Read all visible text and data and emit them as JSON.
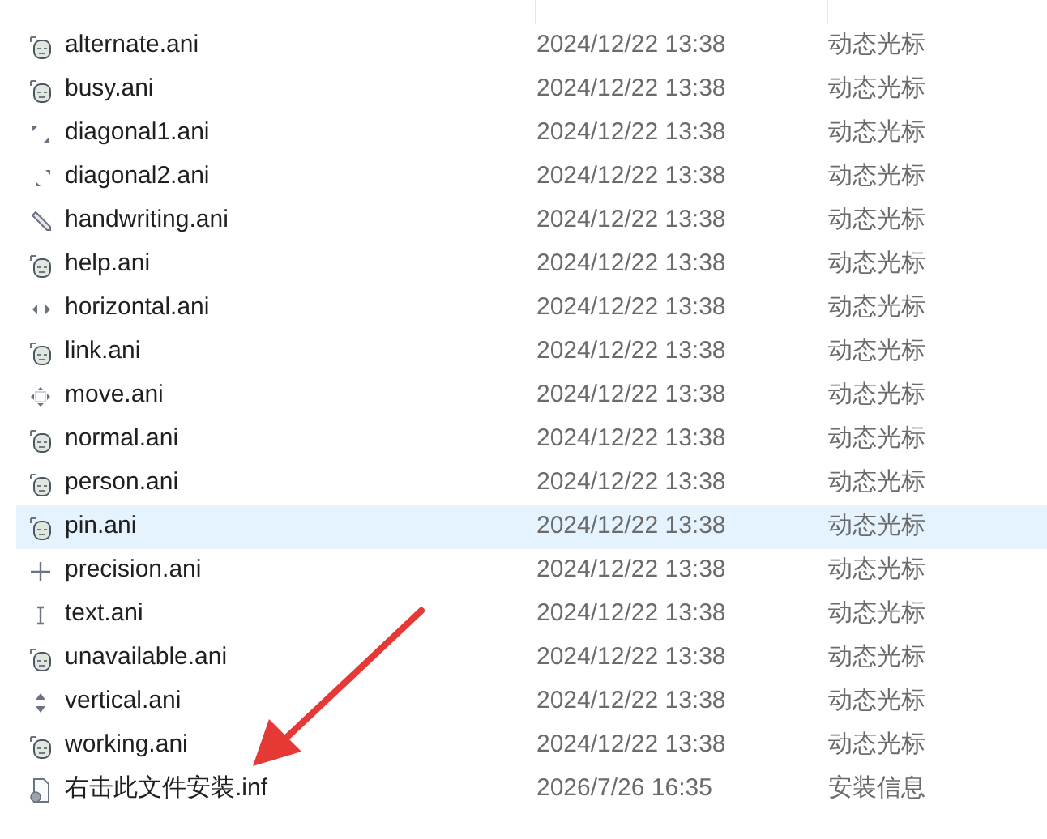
{
  "files": [
    {
      "name": "alternate.ani",
      "date": "2024/12/22 13:38",
      "type": "动态光标",
      "kind": "cursor",
      "selected": false
    },
    {
      "name": "busy.ani",
      "date": "2024/12/22 13:38",
      "type": "动态光标",
      "kind": "cursor",
      "selected": false
    },
    {
      "name": "diagonal1.ani",
      "date": "2024/12/22 13:38",
      "type": "动态光标",
      "kind": "diagonal1",
      "selected": false
    },
    {
      "name": "diagonal2.ani",
      "date": "2024/12/22 13:38",
      "type": "动态光标",
      "kind": "diagonal2",
      "selected": false
    },
    {
      "name": "handwriting.ani",
      "date": "2024/12/22 13:38",
      "type": "动态光标",
      "kind": "pencil",
      "selected": false
    },
    {
      "name": "help.ani",
      "date": "2024/12/22 13:38",
      "type": "动态光标",
      "kind": "cursor",
      "selected": false
    },
    {
      "name": "horizontal.ani",
      "date": "2024/12/22 13:38",
      "type": "动态光标",
      "kind": "horizontal",
      "selected": false
    },
    {
      "name": "link.ani",
      "date": "2024/12/22 13:38",
      "type": "动态光标",
      "kind": "cursor",
      "selected": false
    },
    {
      "name": "move.ani",
      "date": "2024/12/22 13:38",
      "type": "动态光标",
      "kind": "move",
      "selected": false
    },
    {
      "name": "normal.ani",
      "date": "2024/12/22 13:38",
      "type": "动态光标",
      "kind": "cursor",
      "selected": false
    },
    {
      "name": "person.ani",
      "date": "2024/12/22 13:38",
      "type": "动态光标",
      "kind": "cursor",
      "selected": false
    },
    {
      "name": "pin.ani",
      "date": "2024/12/22 13:38",
      "type": "动态光标",
      "kind": "cursor",
      "selected": true
    },
    {
      "name": "precision.ani",
      "date": "2024/12/22 13:38",
      "type": "动态光标",
      "kind": "precision",
      "selected": false
    },
    {
      "name": "text.ani",
      "date": "2024/12/22 13:38",
      "type": "动态光标",
      "kind": "text",
      "selected": false
    },
    {
      "name": "unavailable.ani",
      "date": "2024/12/22 13:38",
      "type": "动态光标",
      "kind": "cursor",
      "selected": false
    },
    {
      "name": "vertical.ani",
      "date": "2024/12/22 13:38",
      "type": "动态光标",
      "kind": "vertical",
      "selected": false
    },
    {
      "name": "working.ani",
      "date": "2024/12/22 13:38",
      "type": "动态光标",
      "kind": "cursor",
      "selected": false
    },
    {
      "name": "右击此文件安装.inf",
      "date": "2026/7/26 16:35",
      "type": "安装信息",
      "kind": "setup",
      "selected": false
    }
  ]
}
